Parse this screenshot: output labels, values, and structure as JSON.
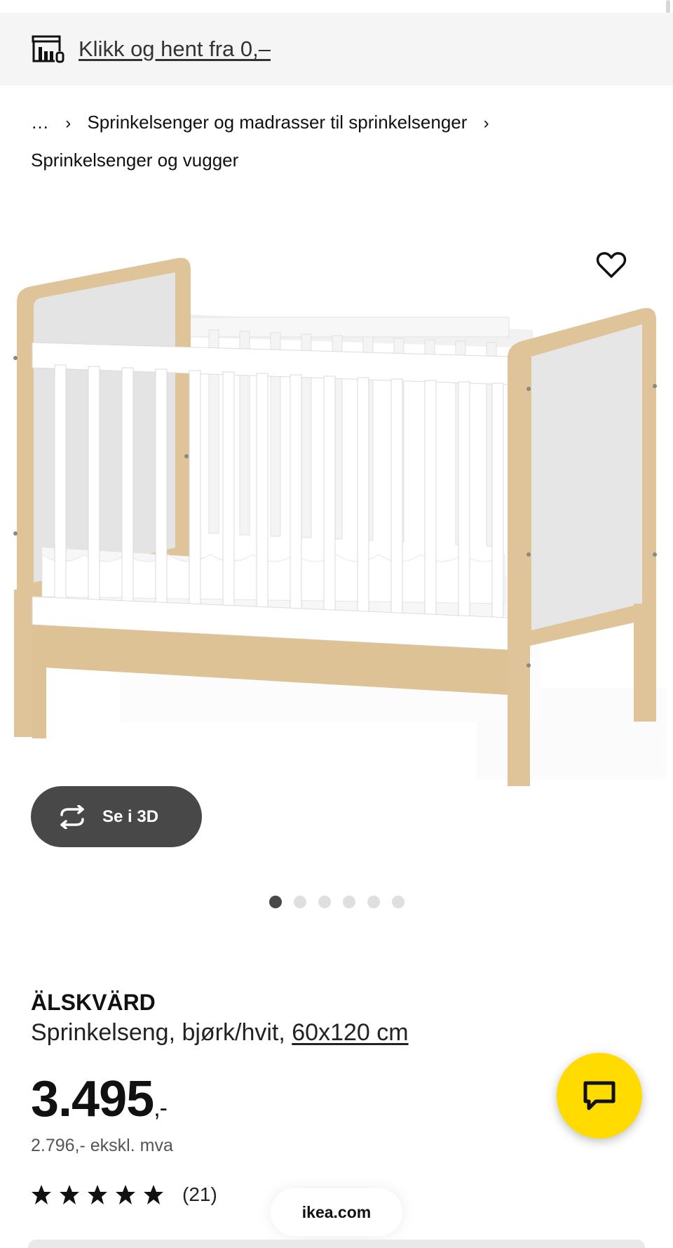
{
  "pickup_banner": {
    "link_text": "Klikk og hent fra 0,–",
    "icon": "store-pickup-icon"
  },
  "breadcrumb": {
    "ellipsis": "…",
    "items": [
      "Sprinkelsenger og madrasser til sprinkelsenger",
      "Sprinkelsenger og vugger"
    ]
  },
  "gallery": {
    "image_count": 6,
    "active_index": 0,
    "favorite_icon": "heart-icon",
    "view_3d_label": "Se i 3D"
  },
  "product": {
    "name": "ÄLSKVÄRD",
    "description": "Sprinkelseng, bjørk/hvit, ",
    "size_link": "60x120 cm",
    "price_main": "3.495",
    "price_suffix": ",-",
    "price_excl_vat": "2.796,- ekskl. mva",
    "rating": 5,
    "review_count": "(21)"
  },
  "chat_button_icon": "chat-bubble-icon",
  "browser": {
    "url_label": "ikea.com"
  },
  "colors": {
    "accent_yellow": "#ffdb00",
    "dark_button": "#484848",
    "banner_bg": "#f5f5f5"
  }
}
